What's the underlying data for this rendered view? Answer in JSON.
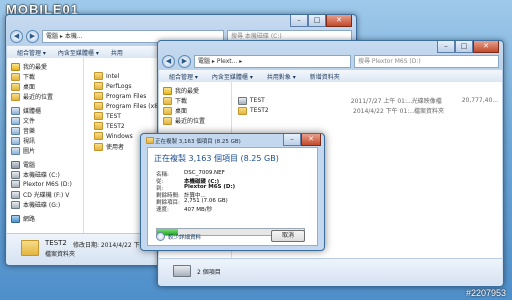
{
  "brand": "MOBILE01",
  "watermark": "#2207953",
  "back_window": {
    "address": "電腦 ▸ 本機...",
    "search_placeholder": "搜尋 本機磁碟 (C:)",
    "toolbar": [
      "組合管理 ▾",
      "內含至媒體櫃 ▾",
      "共用"
    ],
    "nav": [
      {
        "label": "我的最愛",
        "icon": "star"
      },
      {
        "label": "下載",
        "icon": "fold"
      },
      {
        "label": "桌面",
        "icon": "fold"
      },
      {
        "label": "最近的位置",
        "icon": "fold"
      },
      {
        "label": "媒體櫃",
        "icon": "lib"
      },
      {
        "label": "文件",
        "icon": "lib"
      },
      {
        "label": "音樂",
        "icon": "lib"
      },
      {
        "label": "視訊",
        "icon": "lib"
      },
      {
        "label": "圖片",
        "icon": "lib"
      },
      {
        "label": "電腦",
        "icon": "pc"
      },
      {
        "label": "本機磁碟 (C:)",
        "icon": "drive"
      },
      {
        "label": "Plextor M6S (D:)",
        "icon": "drive"
      },
      {
        "label": "CD 光碟機 (F:) V",
        "icon": "drive"
      },
      {
        "label": "本機磁碟 (G:)",
        "icon": "drive"
      },
      {
        "label": "網路",
        "icon": "net"
      }
    ],
    "files": [
      "Intel",
      "PerfLogs",
      "Program Files",
      "Program Files (x86)",
      "TEST",
      "TEST2",
      "Windows",
      "使用者"
    ],
    "status": {
      "name": "TEST2",
      "date": "修改日期: 2014/4/22 下午",
      "type": "檔案資料夾"
    }
  },
  "front_window": {
    "address": "電腦 ▸ Plext... ▸",
    "search_placeholder": "搜尋 Plextor M6S (D:)",
    "toolbar": [
      "組合管理 ▾",
      "內含至媒體櫃 ▾",
      "共用對象 ▾",
      "新增資料夾"
    ],
    "nav": [
      {
        "label": "我的最愛",
        "icon": "star"
      },
      {
        "label": "下載",
        "icon": "fold"
      },
      {
        "label": "桌面",
        "icon": "fold"
      },
      {
        "label": "最近的位置",
        "icon": "fold"
      }
    ],
    "files": [
      {
        "name": "TEST",
        "date": "2011/7/27 上午 01:...",
        "type": "光碟映像檔",
        "size": "20,777,40..."
      },
      {
        "name": "TEST2",
        "date": "2014/4/22 下午 01:...",
        "type": "檔案資料夾",
        "size": ""
      }
    ],
    "status": "2 個項目"
  },
  "dialog": {
    "title": "正在複製 3,163 個項目 (8.25 GB)",
    "heading": "正在複製 3,163 個項目 (8.25 GB)",
    "rows": [
      {
        "k": "名稱:",
        "v": "DSC_7009.NEF"
      },
      {
        "k": "從:",
        "v": "本機磁碟 (C:)"
      },
      {
        "k": "到:",
        "v": "Plextor M6S (D:)"
      },
      {
        "k": "剩餘時間:",
        "v": "計算中..."
      },
      {
        "k": "剩餘項目:",
        "v": "2,751 (7.06 GB)"
      },
      {
        "k": "速度:",
        "v": "407 MB/秒"
      }
    ],
    "progress": 0.14,
    "more": "較少詳細資料",
    "cancel": "取消"
  }
}
